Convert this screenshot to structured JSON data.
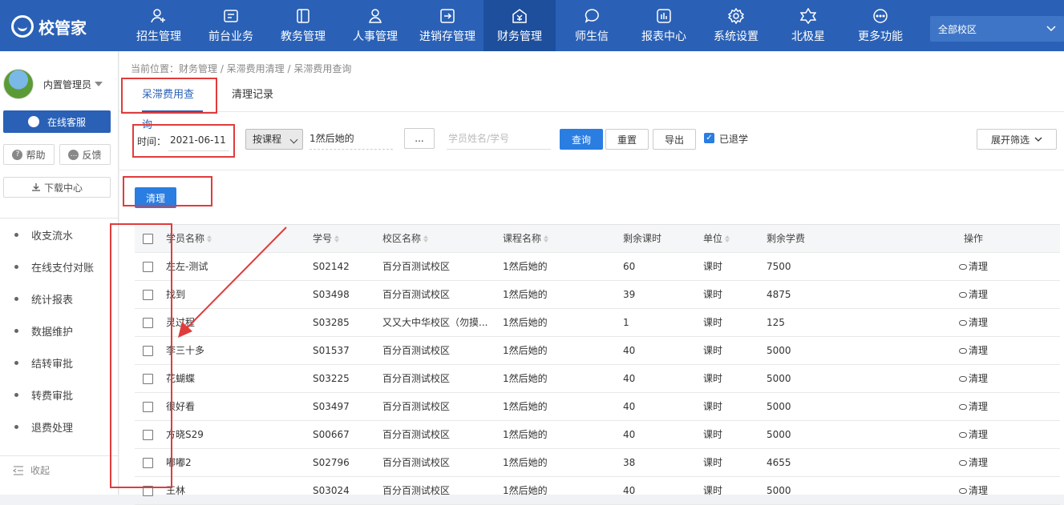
{
  "brand": {
    "name": "校管家"
  },
  "nav": [
    {
      "label": "招生管理",
      "icon": "add-user-icon"
    },
    {
      "label": "前台业务",
      "icon": "reception-icon"
    },
    {
      "label": "教务管理",
      "icon": "book-icon"
    },
    {
      "label": "人事管理",
      "icon": "person-icon"
    },
    {
      "label": "进销存管理",
      "icon": "inventory-icon"
    },
    {
      "label": "财务管理",
      "icon": "finance-icon",
      "active": true
    },
    {
      "label": "师生信",
      "icon": "chat-icon"
    },
    {
      "label": "报表中心",
      "icon": "report-icon"
    },
    {
      "label": "系统设置",
      "icon": "gear-icon"
    },
    {
      "label": "北极星",
      "icon": "star-icon"
    },
    {
      "label": "更多功能",
      "icon": "more-icon"
    }
  ],
  "campus_select": {
    "value": "全部校区"
  },
  "sidebar": {
    "user": "内置管理员",
    "online_service": "在线客服",
    "help": "帮助",
    "feedback": "反馈",
    "download": "下载中心",
    "menu": [
      "收支流水",
      "在线支付对账",
      "统计报表",
      "数据维护",
      "结转审批",
      "转费审批",
      "退费处理"
    ],
    "collapse": "收起"
  },
  "breadcrumb": "当前位置：财务管理 / 呆滞费用清理 / 呆滞费用查询",
  "tabs": [
    "呆滞费用查询",
    "清理记录"
  ],
  "filter": {
    "time_label": "时间：",
    "date": "2021-06-11",
    "mode": "按课程",
    "course": "1然后她的",
    "more": "...",
    "search_placeholder": "学员姓名/学号",
    "query": "查询",
    "reset": "重置",
    "export": "导出",
    "withdrawn_label": "已退学",
    "expand": "展开筛选"
  },
  "clean_button": "清理",
  "table": {
    "headers": [
      "学员名称",
      "学号",
      "校区名称",
      "课程名称",
      "剩余课时",
      "单位",
      "剩余学费",
      "操作"
    ],
    "rows": [
      [
        "左左-测试",
        "S02142",
        "百分百测试校区",
        "1然后她的",
        "60",
        "课时",
        "7500",
        "清理"
      ],
      [
        "找到",
        "S03498",
        "百分百测试校区",
        "1然后她的",
        "39",
        "课时",
        "4875",
        "清理"
      ],
      [
        "灵过程",
        "S03285",
        "又又大中华校区（勿摸...",
        "1然后她的",
        "1",
        "课时",
        "125",
        "清理"
      ],
      [
        "李三十多",
        "S01537",
        "百分百测试校区",
        "1然后她的",
        "40",
        "课时",
        "5000",
        "清理"
      ],
      [
        "花蝴蝶",
        "S03225",
        "百分百测试校区",
        "1然后她的",
        "40",
        "课时",
        "5000",
        "清理"
      ],
      [
        "很好看",
        "S03497",
        "百分百测试校区",
        "1然后她的",
        "40",
        "课时",
        "5000",
        "清理"
      ],
      [
        "方晓S29",
        "S00667",
        "百分百测试校区",
        "1然后她的",
        "40",
        "课时",
        "5000",
        "清理"
      ],
      [
        "嘟嘟2",
        "S02796",
        "百分百测试校区",
        "1然后她的",
        "38",
        "课时",
        "4655",
        "清理"
      ],
      [
        "王林",
        "S03024",
        "百分百测试校区",
        "1然后她的",
        "40",
        "课时",
        "5000",
        "清理"
      ]
    ]
  },
  "colors": {
    "primary": "#2a61b6",
    "accent": "#2a7de1",
    "highlight": "#e03c3c"
  }
}
